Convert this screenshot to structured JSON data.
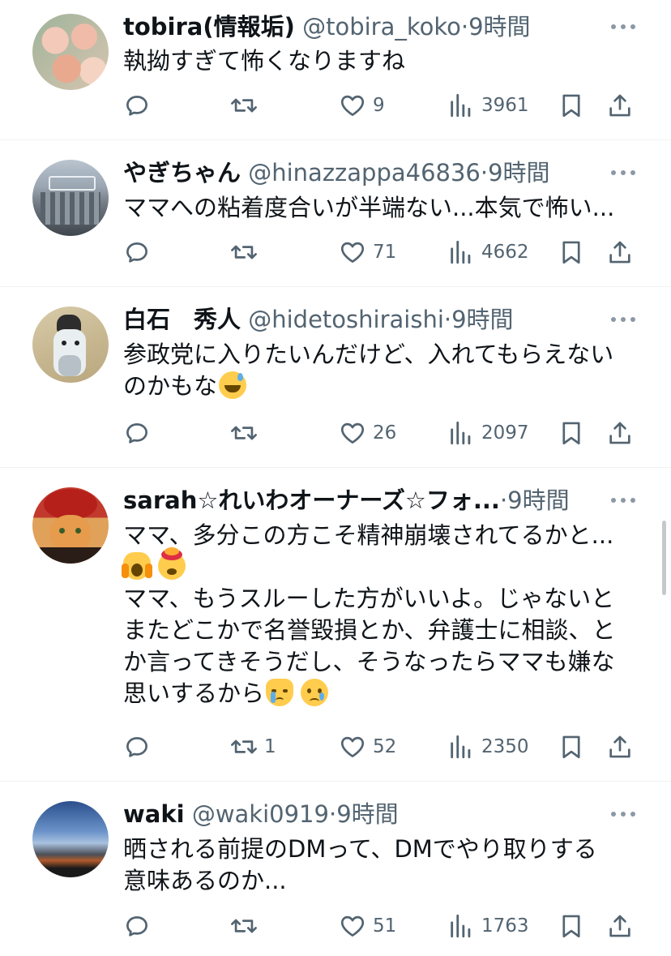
{
  "tweets": [
    {
      "name": "tobira(情報垢)",
      "handle": "@tobira_koko",
      "dot": "·",
      "time": "9時間",
      "text": "執拗すぎて怖くなりますね",
      "retweets": "",
      "likes": "9",
      "views": "3961"
    },
    {
      "name": "やぎちゃん",
      "handle": "@hinazzappa46836",
      "dot": "·",
      "time": "9時間",
      "text": "ママへの粘着度合いが半端ない...本気で怖い...",
      "retweets": "",
      "likes": "71",
      "views": "4662"
    },
    {
      "name": "白石　秀人",
      "handle": "@hidetoshiraishi",
      "dot": "·",
      "time": "9時間",
      "text_line1": "参政党に入りたいんだけど、入れてもらえない",
      "text_line2": "のかもな",
      "retweets": "",
      "likes": "26",
      "views": "2097"
    },
    {
      "name": "sarah☆れいわオーナーズ☆フォ...",
      "handle": "",
      "dot": "·",
      "time": "9時間",
      "text_line1": "ママ、多分この方こそ精神崩壊されてるかと...",
      "text_line3": "ママ、もうスルーした方がいいよ。じゃないと",
      "text_line4": "またどこかで名誉毀損とか、弁護士に相談、と",
      "text_line5": "か言ってきそうだし、そうなったらママも嫌な",
      "text_line6": "思いするから",
      "retweets": "1",
      "likes": "52",
      "views": "2350"
    },
    {
      "name": "waki",
      "handle": "@waki0919",
      "dot": "·",
      "time": "9時間",
      "text_line1": "晒される前提のDMって、DMでやり取りする",
      "text_line2": "意味あるのか...",
      "retweets": "",
      "likes": "51",
      "views": "1763"
    }
  ],
  "icons": [
    "reply-icon",
    "retweet-icon",
    "like-icon",
    "views-icon",
    "bookmark-icon",
    "share-icon",
    "more-icon"
  ],
  "colors": {
    "text": "#0f1419",
    "secondary": "#536471",
    "divider": "#eff3f4"
  }
}
